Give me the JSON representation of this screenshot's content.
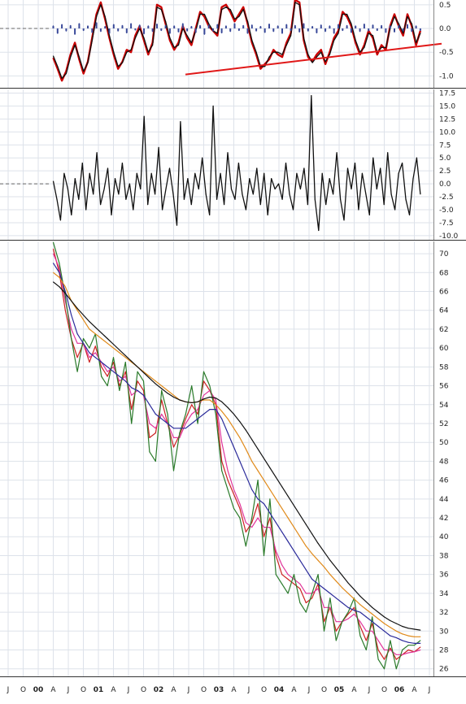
{
  "chart_data": [
    {
      "type": "line",
      "panel": "oscillator",
      "ylim": [
        -1.25,
        0.6
      ],
      "yticks": [
        "0.5",
        "0.0",
        "-0.5",
        "-1.0"
      ],
      "ytick_values": [
        0.5,
        0.0,
        -0.5,
        -1.0
      ],
      "grid": true,
      "zero_line": true,
      "series": [
        {
          "color": "#cc0000",
          "style": "thick",
          "values": [
            -0.62,
            -0.85,
            -1.1,
            -0.9,
            -0.55,
            -0.3,
            -0.65,
            -0.95,
            -0.7,
            -0.2,
            0.3,
            0.55,
            0.2,
            -0.2,
            -0.55,
            -0.85,
            -0.7,
            -0.45,
            -0.5,
            -0.15,
            0.05,
            -0.25,
            -0.55,
            -0.3,
            0.5,
            0.45,
            0.1,
            -0.25,
            -0.45,
            -0.3,
            0.05,
            -0.2,
            -0.35,
            0.0,
            0.35,
            0.25,
            0.05,
            -0.05,
            -0.15,
            0.45,
            0.5,
            0.35,
            0.15,
            0.3,
            0.45,
            0.1,
            -0.3,
            -0.55,
            -0.85,
            -0.75,
            -0.65,
            -0.45,
            -0.55,
            -0.6,
            -0.3,
            -0.1,
            0.6,
            0.55,
            -0.25,
            -0.6,
            -0.7,
            -0.55,
            -0.45,
            -0.75,
            -0.5,
            -0.2,
            -0.05,
            0.35,
            0.25,
            0.05,
            -0.3,
            -0.55,
            -0.35,
            -0.05,
            -0.2,
            -0.55,
            -0.35,
            -0.45,
            0.05,
            0.3,
            0.05,
            -0.15,
            0.3,
            0.05,
            -0.35,
            -0.05
          ]
        },
        {
          "color": "#111111",
          "style": "thin",
          "values": [
            -0.58,
            -0.8,
            -1.05,
            -0.95,
            -0.6,
            -0.35,
            -0.6,
            -0.9,
            -0.72,
            -0.25,
            0.25,
            0.5,
            0.25,
            -0.15,
            -0.5,
            -0.8,
            -0.72,
            -0.5,
            -0.45,
            -0.2,
            0.0,
            -0.2,
            -0.5,
            -0.35,
            0.45,
            0.4,
            0.15,
            -0.2,
            -0.4,
            -0.35,
            0.0,
            -0.15,
            -0.3,
            -0.05,
            0.3,
            0.3,
            0.1,
            -0.05,
            -0.1,
            0.4,
            0.45,
            0.4,
            0.2,
            0.25,
            0.4,
            0.15,
            -0.25,
            -0.5,
            -0.8,
            -0.8,
            -0.6,
            -0.5,
            -0.5,
            -0.55,
            -0.35,
            -0.15,
            0.55,
            0.5,
            -0.2,
            -0.55,
            -0.72,
            -0.6,
            -0.5,
            -0.7,
            -0.55,
            -0.25,
            -0.1,
            0.3,
            0.3,
            0.1,
            -0.25,
            -0.5,
            -0.4,
            -0.1,
            -0.15,
            -0.5,
            -0.4,
            -0.4,
            0.0,
            0.25,
            0.1,
            -0.1,
            0.25,
            0.1,
            -0.3,
            -0.1
          ]
        },
        {
          "color": "#3a4a9a",
          "style": "histogram",
          "values": [
            0.05,
            -0.1,
            0.08,
            -0.05,
            0.06,
            -0.12,
            0.1,
            -0.04,
            0.05,
            -0.08,
            0.12,
            -0.06,
            0.04,
            -0.1,
            0.08,
            -0.05,
            0.06,
            -0.09,
            0.1,
            -0.03,
            0.07,
            -0.11,
            0.05,
            -0.06,
            0.09,
            -0.04,
            0.06,
            -0.1,
            0.05,
            -0.07,
            0.1,
            -0.05,
            0.04,
            -0.08,
            0.06,
            -0.12,
            0.07,
            -0.05,
            0.08,
            -0.09,
            0.05,
            -0.06,
            0.1,
            -0.04,
            0.06,
            -0.1,
            0.07,
            -0.05,
            0.04,
            -0.08,
            0.09,
            -0.06,
            0.05,
            -0.1,
            0.08,
            -0.04,
            0.06,
            -0.07,
            0.1,
            -0.05,
            0.04,
            -0.09,
            0.07,
            -0.06,
            0.05,
            -0.1,
            0.08,
            -0.04,
            0.06,
            -0.08,
            0.05,
            -0.06,
            0.09,
            -0.05,
            0.07,
            -0.04,
            0.06,
            -0.08,
            0.05,
            -0.07,
            0.06,
            -0.05,
            0.08,
            -0.06,
            0.05,
            -0.04
          ]
        }
      ],
      "trendline": {
        "color": "#e01818",
        "x": [
          0.42,
          1.0
        ],
        "y": [
          -0.97,
          -0.32
        ]
      }
    },
    {
      "type": "line",
      "panel": "momentum",
      "ylim": [
        -10.8,
        18.2
      ],
      "yticks": [
        "17.5",
        "15.0",
        "12.5",
        "10.0",
        "7.5",
        "5.0",
        "2.5",
        "0.0",
        "-2.5",
        "-5.0",
        "-7.5",
        "-10.0"
      ],
      "ytick_values": [
        17.5,
        15.0,
        12.5,
        10.0,
        7.5,
        5.0,
        2.5,
        0.0,
        -2.5,
        -5.0,
        -7.5,
        -10.0
      ],
      "grid": true,
      "zero_line": true,
      "series": [
        {
          "color": "#111111",
          "values": [
            0.5,
            -3,
            -7,
            2,
            -1,
            -6,
            1,
            -3,
            4,
            -5,
            2,
            -2,
            6,
            -4,
            -1,
            3,
            -6,
            1,
            -2,
            4,
            -3,
            0,
            -5,
            2,
            -1,
            13,
            -4,
            2,
            -2,
            7,
            -5,
            -1,
            3,
            -2,
            -8,
            12,
            -3,
            1,
            -4,
            2,
            -1,
            5,
            -2,
            -6,
            15,
            -3,
            2,
            -4,
            6,
            -1,
            -3,
            4,
            -2,
            -5,
            1,
            -2,
            3,
            -4,
            2,
            -6,
            1,
            -1,
            0,
            -3,
            4,
            -2,
            -5,
            2,
            -1,
            3,
            -4,
            17,
            -3,
            -9,
            2,
            -4,
            1,
            -2,
            6,
            -3,
            -7,
            3,
            -1,
            4,
            -5,
            2,
            -2,
            -6,
            5,
            -1,
            3,
            -4,
            6,
            -2,
            -5,
            2,
            4,
            -3,
            -6,
            1,
            5,
            -2
          ]
        }
      ]
    },
    {
      "type": "line",
      "panel": "price",
      "xlabel": "",
      "ylabel": "",
      "ylim": [
        25.2,
        71.3
      ],
      "yticks": [
        "70",
        "68",
        "66",
        "64",
        "62",
        "60",
        "58",
        "56",
        "54",
        "52",
        "50",
        "48",
        "46",
        "44",
        "42",
        "40",
        "38",
        "36",
        "34",
        "32",
        "30",
        "28",
        "26"
      ],
      "ytick_values": [
        70,
        68,
        66,
        64,
        62,
        60,
        58,
        56,
        54,
        52,
        50,
        48,
        46,
        44,
        42,
        40,
        38,
        36,
        34,
        32,
        30,
        28,
        26
      ],
      "xticks": [
        "J",
        "O",
        "00",
        "A",
        "J",
        "O",
        "01",
        "A",
        "J",
        "O",
        "02",
        "A",
        "J",
        "O",
        "03",
        "A",
        "J",
        "O",
        "04",
        "A",
        "J",
        "O",
        "05",
        "A",
        "J",
        "O",
        "06",
        "A",
        "J"
      ],
      "xlim": [
        0,
        28
      ],
      "grid": true,
      "x": [
        3.0,
        3.4,
        3.8,
        4.2,
        4.6,
        5.0,
        5.4,
        5.8,
        6.2,
        6.6,
        7.0,
        7.4,
        7.8,
        8.2,
        8.6,
        9.0,
        9.4,
        9.8,
        10.2,
        10.6,
        11.0,
        11.4,
        11.8,
        12.2,
        12.6,
        13.0,
        13.4,
        13.8,
        14.2,
        14.6,
        15.0,
        15.4,
        15.8,
        16.2,
        16.6,
        17.0,
        17.4,
        17.8,
        18.2,
        18.6,
        19.0,
        19.4,
        19.8,
        20.2,
        20.6,
        21.0,
        21.4,
        21.8,
        22.2,
        22.6,
        23.0,
        23.4,
        23.8,
        24.2,
        24.6,
        25.0,
        25.4,
        25.8,
        26.2,
        26.6,
        27.0,
        27.4
      ],
      "series": [
        {
          "color": "#cc2222",
          "values": [
            70.5,
            68,
            64,
            61,
            59,
            60.5,
            58.5,
            60.2,
            58,
            57,
            58.5,
            56,
            57.5,
            53.5,
            56.5,
            55.5,
            50.5,
            51,
            54.5,
            52,
            49.5,
            50.8,
            52.5,
            54,
            53,
            56.5,
            55.5,
            54,
            48,
            46,
            44.5,
            43,
            40.5,
            41.5,
            43.5,
            40,
            42,
            38,
            36,
            35.5,
            35,
            34.5,
            33,
            33.5,
            35,
            31,
            32.5,
            30,
            31,
            31.8,
            32.5,
            30.5,
            29,
            30.8,
            28,
            27,
            28.2,
            27,
            27.5,
            28,
            27.8,
            28.3
          ]
        },
        {
          "color": "#e0349a",
          "values": [
            70,
            68.5,
            65,
            62,
            60.5,
            60.5,
            59,
            59.5,
            58.5,
            57.5,
            58,
            56.5,
            57,
            55,
            55.5,
            55,
            52,
            51.5,
            53,
            52,
            50.5,
            50.5,
            52,
            53,
            53.5,
            55,
            55.5,
            54.5,
            50,
            47,
            45,
            43.5,
            41.5,
            41,
            42,
            41,
            41,
            38.5,
            37,
            36,
            35.5,
            35,
            34,
            34,
            34.5,
            32.5,
            32.5,
            31,
            31,
            31.3,
            31.8,
            31,
            30,
            30,
            29,
            28,
            28,
            27.5,
            27.5,
            27.7,
            27.8,
            28
          ]
        },
        {
          "color": "#2a7a2a",
          "values": [
            71.2,
            69,
            65.5,
            61,
            57.5,
            61,
            60,
            61.5,
            57,
            56,
            59,
            55.5,
            58.5,
            52,
            57.5,
            56.5,
            49,
            48,
            55.5,
            53,
            47,
            51,
            53,
            56,
            52,
            57.5,
            56,
            53,
            47,
            45,
            43,
            42,
            39,
            42,
            46,
            38,
            44,
            36,
            35,
            34,
            36,
            33,
            32,
            34,
            36,
            30,
            33.5,
            29,
            31,
            32,
            33.5,
            29.5,
            28,
            31.5,
            27,
            26,
            29,
            26,
            28,
            28.5,
            28.5,
            29
          ]
        },
        {
          "color": "#2a2a9a",
          "values": [
            69,
            68,
            66,
            63.5,
            61.5,
            60.5,
            59.5,
            59,
            58.5,
            58,
            57.5,
            57,
            56.5,
            55.8,
            55.5,
            55,
            54,
            53,
            52.5,
            52,
            51.5,
            51.5,
            51.5,
            52,
            52.5,
            53,
            53.5,
            53.5,
            52.5,
            51,
            49.5,
            48,
            46.5,
            45,
            44,
            43.5,
            42.5,
            41.5,
            40.5,
            39.5,
            38.5,
            37.5,
            36.5,
            35.5,
            35,
            34.5,
            34,
            33.5,
            33,
            32.5,
            32.2,
            32,
            31.5,
            31,
            30.5,
            30,
            29.5,
            29.3,
            29,
            28.8,
            28.7,
            28.7
          ]
        },
        {
          "color": "#e08a1a",
          "values": [
            68,
            67.5,
            66.5,
            65,
            64,
            63,
            62,
            61.5,
            61,
            60.5,
            60,
            59.5,
            59,
            58.5,
            58,
            57.5,
            57,
            56.5,
            56,
            55.5,
            55,
            54.5,
            54.3,
            54.2,
            54.3,
            54.5,
            54.5,
            54,
            53.3,
            52.5,
            51.5,
            50.5,
            49.3,
            48,
            47,
            46,
            45,
            44,
            43,
            42,
            41,
            40,
            39,
            38.2,
            37.5,
            36.8,
            36,
            35.3,
            34.6,
            34,
            33.4,
            32.8,
            32.3,
            31.8,
            31.3,
            30.8,
            30.4,
            30,
            29.7,
            29.5,
            29.4,
            29.4
          ]
        },
        {
          "color": "#111111",
          "values": [
            67,
            66.5,
            65.8,
            65,
            64.2,
            63.5,
            62.8,
            62.2,
            61.6,
            61,
            60.4,
            59.8,
            59.2,
            58.6,
            58,
            57.4,
            56.8,
            56.2,
            55.7,
            55.2,
            54.8,
            54.5,
            54.3,
            54.2,
            54.3,
            54.6,
            54.8,
            54.7,
            54.3,
            53.7,
            53,
            52.2,
            51.3,
            50.3,
            49.3,
            48.3,
            47.3,
            46.3,
            45.3,
            44.3,
            43.3,
            42.3,
            41.3,
            40.3,
            39.3,
            38.4,
            37.5,
            36.7,
            35.9,
            35.1,
            34.4,
            33.7,
            33.1,
            32.5,
            32,
            31.5,
            31.1,
            30.8,
            30.5,
            30.3,
            30.2,
            30.1
          ]
        }
      ]
    }
  ]
}
